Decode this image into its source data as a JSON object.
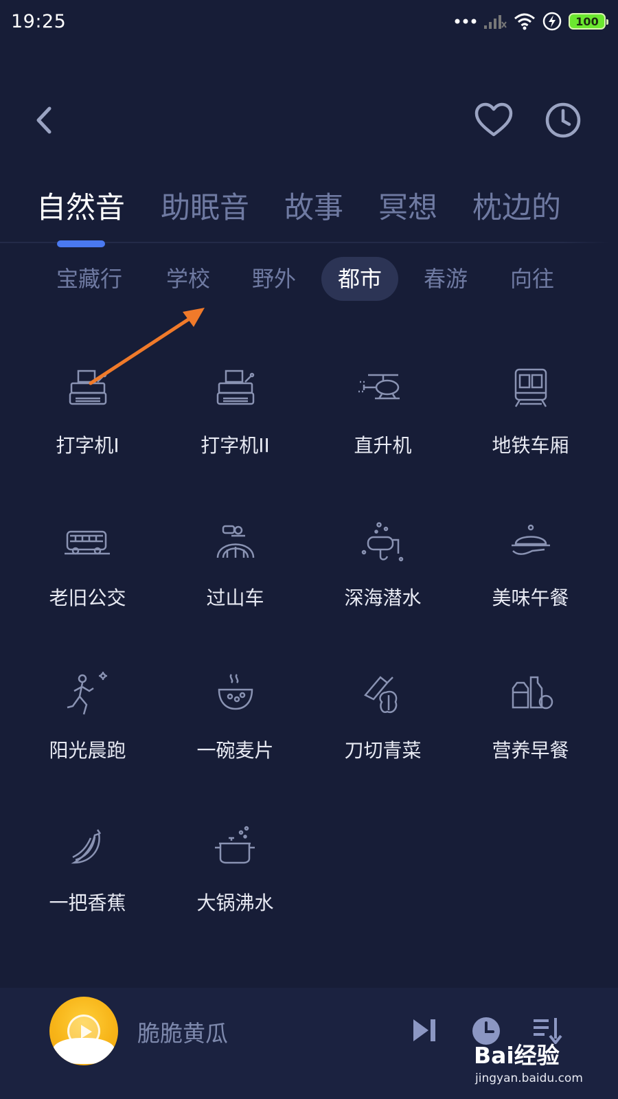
{
  "status_bar": {
    "time": "19:25",
    "battery": "100"
  },
  "category_tabs": [
    {
      "label": "自然音",
      "active": true
    },
    {
      "label": "助眠音",
      "active": false
    },
    {
      "label": "故事",
      "active": false
    },
    {
      "label": "冥想",
      "active": false
    },
    {
      "label": "枕边的",
      "active": false
    }
  ],
  "sub_tabs": [
    {
      "label": "宝藏行",
      "active": false
    },
    {
      "label": "学校",
      "active": false
    },
    {
      "label": "野外",
      "active": false
    },
    {
      "label": "都市",
      "active": true
    },
    {
      "label": "春游",
      "active": false
    },
    {
      "label": "向往",
      "active": false
    }
  ],
  "sounds": [
    {
      "label": "打字机I",
      "icon": "typewriter-icon"
    },
    {
      "label": "打字机II",
      "icon": "typewriter-icon"
    },
    {
      "label": "直升机",
      "icon": "helicopter-icon"
    },
    {
      "label": "地铁车厢",
      "icon": "subway-icon"
    },
    {
      "label": "老旧公交",
      "icon": "bus-icon"
    },
    {
      "label": "过山车",
      "icon": "roller-coaster-icon"
    },
    {
      "label": "深海潜水",
      "icon": "diving-mask-icon"
    },
    {
      "label": "美味午餐",
      "icon": "dish-cloche-icon"
    },
    {
      "label": "阳光晨跑",
      "icon": "runner-icon"
    },
    {
      "label": "一碗麦片",
      "icon": "cereal-bowl-icon"
    },
    {
      "label": "刀切青菜",
      "icon": "knife-vegetable-icon"
    },
    {
      "label": "营养早餐",
      "icon": "breakfast-icon"
    },
    {
      "label": "一把香蕉",
      "icon": "banana-icon"
    },
    {
      "label": "大锅沸水",
      "icon": "boiling-pot-icon"
    }
  ],
  "player": {
    "track_title": "脆脆黄瓜"
  },
  "watermark": {
    "logo": "Bai经验",
    "url": "jingyan.baidu.com"
  },
  "colors": {
    "background": "#171d37",
    "active_indicator": "#4a79f0",
    "inactive_text": "#6f7aa2",
    "annotation_arrow": "#f07a2a"
  }
}
